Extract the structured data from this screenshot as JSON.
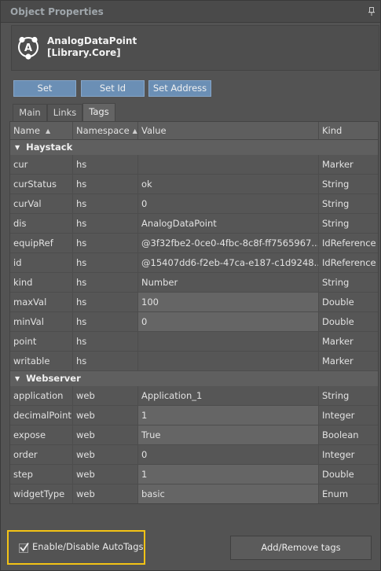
{
  "panel": {
    "title": "Object Properties"
  },
  "object": {
    "name": "AnalogDataPoint",
    "library": "[Library.Core]",
    "icon": "analog-point-icon"
  },
  "actions": {
    "set": "Set",
    "set_id": "Set Id",
    "set_address": "Set Address"
  },
  "tabs": [
    {
      "label": "Main"
    },
    {
      "label": "Links"
    },
    {
      "label": "Tags",
      "active": true
    }
  ],
  "columns": {
    "name": "Name",
    "namespace": "Namespace",
    "value": "Value",
    "kind": "Kind"
  },
  "groups": [
    {
      "label": "Haystack",
      "rows": [
        {
          "name": "cur",
          "namespace": "hs",
          "value": "",
          "kind": "Marker"
        },
        {
          "name": "curStatus",
          "namespace": "hs",
          "value": "ok",
          "kind": "String"
        },
        {
          "name": "curVal",
          "namespace": "hs",
          "value": "0",
          "kind": "String"
        },
        {
          "name": "dis",
          "namespace": "hs",
          "value": "AnalogDataPoint",
          "kind": "String"
        },
        {
          "name": "equipRef",
          "namespace": "hs",
          "value": "@3f32fbe2-0ce0-4fbc-8c8f-ff7565967...",
          "kind": "IdReference"
        },
        {
          "name": "id",
          "namespace": "hs",
          "value": "@15407dd6-f2eb-47ca-e187-c1d9248...",
          "kind": "IdReference"
        },
        {
          "name": "kind",
          "namespace": "hs",
          "value": "Number",
          "kind": "String"
        },
        {
          "name": "maxVal",
          "namespace": "hs",
          "value": "100",
          "kind": "Double"
        },
        {
          "name": "minVal",
          "namespace": "hs",
          "value": "0",
          "kind": "Double"
        },
        {
          "name": "point",
          "namespace": "hs",
          "value": "",
          "kind": "Marker"
        },
        {
          "name": "writable",
          "namespace": "hs",
          "value": "",
          "kind": "Marker"
        }
      ]
    },
    {
      "label": "Webserver",
      "rows": [
        {
          "name": "application",
          "namespace": "web",
          "value": "Application_1",
          "kind": "String"
        },
        {
          "name": "decimalPoint",
          "namespace": "web",
          "value": "1",
          "kind": "Integer"
        },
        {
          "name": "expose",
          "namespace": "web",
          "value": "True",
          "kind": "Boolean"
        },
        {
          "name": "order",
          "namespace": "web",
          "value": "0",
          "kind": "Integer"
        },
        {
          "name": "step",
          "namespace": "web",
          "value": "1",
          "kind": "Double"
        },
        {
          "name": "widgetType",
          "namespace": "web",
          "value": "basic",
          "kind": "Enum"
        }
      ]
    }
  ],
  "footer": {
    "auto_tags_label": "Enable/Disable AutoTags",
    "auto_tags_checked": true,
    "add_remove_label": "Add/Remove tags"
  },
  "colors": {
    "highlight": "#f3c315",
    "action_button": "#6b8fb5"
  }
}
